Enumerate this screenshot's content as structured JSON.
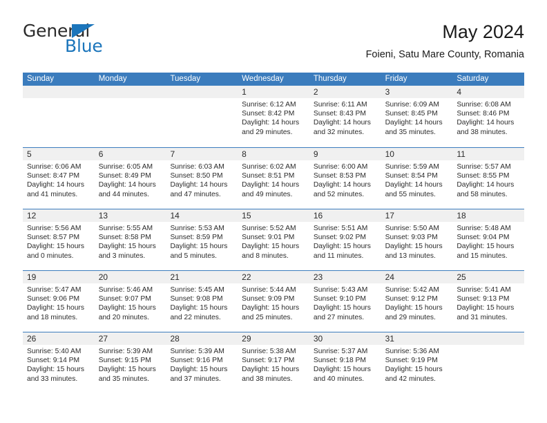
{
  "brand": {
    "line1": "General",
    "line2": "Blue",
    "triangle_color": "#1b75bb"
  },
  "header": {
    "title": "May 2024",
    "subtitle": "Foieni, Satu Mare County, Romania"
  },
  "theme": {
    "header_blue": "#3b7cbd",
    "date_band": "#f0f0f0",
    "text": "#2a2a2a"
  },
  "calendar": {
    "weekday_headers": [
      "Sunday",
      "Monday",
      "Tuesday",
      "Wednesday",
      "Thursday",
      "Friday",
      "Saturday"
    ],
    "weeks": [
      [
        {
          "empty": true,
          "day": "",
          "sunrise": "",
          "sunset": "",
          "daylight_line1": "",
          "daylight_line2": ""
        },
        {
          "empty": true,
          "day": "",
          "sunrise": "",
          "sunset": "",
          "daylight_line1": "",
          "daylight_line2": ""
        },
        {
          "empty": true,
          "day": "",
          "sunrise": "",
          "sunset": "",
          "daylight_line1": "",
          "daylight_line2": ""
        },
        {
          "empty": false,
          "day": "1",
          "sunrise": "Sunrise: 6:12 AM",
          "sunset": "Sunset: 8:42 PM",
          "daylight_line1": "Daylight: 14 hours",
          "daylight_line2": "and 29 minutes."
        },
        {
          "empty": false,
          "day": "2",
          "sunrise": "Sunrise: 6:11 AM",
          "sunset": "Sunset: 8:43 PM",
          "daylight_line1": "Daylight: 14 hours",
          "daylight_line2": "and 32 minutes."
        },
        {
          "empty": false,
          "day": "3",
          "sunrise": "Sunrise: 6:09 AM",
          "sunset": "Sunset: 8:45 PM",
          "daylight_line1": "Daylight: 14 hours",
          "daylight_line2": "and 35 minutes."
        },
        {
          "empty": false,
          "day": "4",
          "sunrise": "Sunrise: 6:08 AM",
          "sunset": "Sunset: 8:46 PM",
          "daylight_line1": "Daylight: 14 hours",
          "daylight_line2": "and 38 minutes."
        }
      ],
      [
        {
          "empty": false,
          "day": "5",
          "sunrise": "Sunrise: 6:06 AM",
          "sunset": "Sunset: 8:47 PM",
          "daylight_line1": "Daylight: 14 hours",
          "daylight_line2": "and 41 minutes."
        },
        {
          "empty": false,
          "day": "6",
          "sunrise": "Sunrise: 6:05 AM",
          "sunset": "Sunset: 8:49 PM",
          "daylight_line1": "Daylight: 14 hours",
          "daylight_line2": "and 44 minutes."
        },
        {
          "empty": false,
          "day": "7",
          "sunrise": "Sunrise: 6:03 AM",
          "sunset": "Sunset: 8:50 PM",
          "daylight_line1": "Daylight: 14 hours",
          "daylight_line2": "and 47 minutes."
        },
        {
          "empty": false,
          "day": "8",
          "sunrise": "Sunrise: 6:02 AM",
          "sunset": "Sunset: 8:51 PM",
          "daylight_line1": "Daylight: 14 hours",
          "daylight_line2": "and 49 minutes."
        },
        {
          "empty": false,
          "day": "9",
          "sunrise": "Sunrise: 6:00 AM",
          "sunset": "Sunset: 8:53 PM",
          "daylight_line1": "Daylight: 14 hours",
          "daylight_line2": "and 52 minutes."
        },
        {
          "empty": false,
          "day": "10",
          "sunrise": "Sunrise: 5:59 AM",
          "sunset": "Sunset: 8:54 PM",
          "daylight_line1": "Daylight: 14 hours",
          "daylight_line2": "and 55 minutes."
        },
        {
          "empty": false,
          "day": "11",
          "sunrise": "Sunrise: 5:57 AM",
          "sunset": "Sunset: 8:55 PM",
          "daylight_line1": "Daylight: 14 hours",
          "daylight_line2": "and 58 minutes."
        }
      ],
      [
        {
          "empty": false,
          "day": "12",
          "sunrise": "Sunrise: 5:56 AM",
          "sunset": "Sunset: 8:57 PM",
          "daylight_line1": "Daylight: 15 hours",
          "daylight_line2": "and 0 minutes."
        },
        {
          "empty": false,
          "day": "13",
          "sunrise": "Sunrise: 5:55 AM",
          "sunset": "Sunset: 8:58 PM",
          "daylight_line1": "Daylight: 15 hours",
          "daylight_line2": "and 3 minutes."
        },
        {
          "empty": false,
          "day": "14",
          "sunrise": "Sunrise: 5:53 AM",
          "sunset": "Sunset: 8:59 PM",
          "daylight_line1": "Daylight: 15 hours",
          "daylight_line2": "and 5 minutes."
        },
        {
          "empty": false,
          "day": "15",
          "sunrise": "Sunrise: 5:52 AM",
          "sunset": "Sunset: 9:01 PM",
          "daylight_line1": "Daylight: 15 hours",
          "daylight_line2": "and 8 minutes."
        },
        {
          "empty": false,
          "day": "16",
          "sunrise": "Sunrise: 5:51 AM",
          "sunset": "Sunset: 9:02 PM",
          "daylight_line1": "Daylight: 15 hours",
          "daylight_line2": "and 11 minutes."
        },
        {
          "empty": false,
          "day": "17",
          "sunrise": "Sunrise: 5:50 AM",
          "sunset": "Sunset: 9:03 PM",
          "daylight_line1": "Daylight: 15 hours",
          "daylight_line2": "and 13 minutes."
        },
        {
          "empty": false,
          "day": "18",
          "sunrise": "Sunrise: 5:48 AM",
          "sunset": "Sunset: 9:04 PM",
          "daylight_line1": "Daylight: 15 hours",
          "daylight_line2": "and 15 minutes."
        }
      ],
      [
        {
          "empty": false,
          "day": "19",
          "sunrise": "Sunrise: 5:47 AM",
          "sunset": "Sunset: 9:06 PM",
          "daylight_line1": "Daylight: 15 hours",
          "daylight_line2": "and 18 minutes."
        },
        {
          "empty": false,
          "day": "20",
          "sunrise": "Sunrise: 5:46 AM",
          "sunset": "Sunset: 9:07 PM",
          "daylight_line1": "Daylight: 15 hours",
          "daylight_line2": "and 20 minutes."
        },
        {
          "empty": false,
          "day": "21",
          "sunrise": "Sunrise: 5:45 AM",
          "sunset": "Sunset: 9:08 PM",
          "daylight_line1": "Daylight: 15 hours",
          "daylight_line2": "and 22 minutes."
        },
        {
          "empty": false,
          "day": "22",
          "sunrise": "Sunrise: 5:44 AM",
          "sunset": "Sunset: 9:09 PM",
          "daylight_line1": "Daylight: 15 hours",
          "daylight_line2": "and 25 minutes."
        },
        {
          "empty": false,
          "day": "23",
          "sunrise": "Sunrise: 5:43 AM",
          "sunset": "Sunset: 9:10 PM",
          "daylight_line1": "Daylight: 15 hours",
          "daylight_line2": "and 27 minutes."
        },
        {
          "empty": false,
          "day": "24",
          "sunrise": "Sunrise: 5:42 AM",
          "sunset": "Sunset: 9:12 PM",
          "daylight_line1": "Daylight: 15 hours",
          "daylight_line2": "and 29 minutes."
        },
        {
          "empty": false,
          "day": "25",
          "sunrise": "Sunrise: 5:41 AM",
          "sunset": "Sunset: 9:13 PM",
          "daylight_line1": "Daylight: 15 hours",
          "daylight_line2": "and 31 minutes."
        }
      ],
      [
        {
          "empty": false,
          "day": "26",
          "sunrise": "Sunrise: 5:40 AM",
          "sunset": "Sunset: 9:14 PM",
          "daylight_line1": "Daylight: 15 hours",
          "daylight_line2": "and 33 minutes."
        },
        {
          "empty": false,
          "day": "27",
          "sunrise": "Sunrise: 5:39 AM",
          "sunset": "Sunset: 9:15 PM",
          "daylight_line1": "Daylight: 15 hours",
          "daylight_line2": "and 35 minutes."
        },
        {
          "empty": false,
          "day": "28",
          "sunrise": "Sunrise: 5:39 AM",
          "sunset": "Sunset: 9:16 PM",
          "daylight_line1": "Daylight: 15 hours",
          "daylight_line2": "and 37 minutes."
        },
        {
          "empty": false,
          "day": "29",
          "sunrise": "Sunrise: 5:38 AM",
          "sunset": "Sunset: 9:17 PM",
          "daylight_line1": "Daylight: 15 hours",
          "daylight_line2": "and 38 minutes."
        },
        {
          "empty": false,
          "day": "30",
          "sunrise": "Sunrise: 5:37 AM",
          "sunset": "Sunset: 9:18 PM",
          "daylight_line1": "Daylight: 15 hours",
          "daylight_line2": "and 40 minutes."
        },
        {
          "empty": false,
          "day": "31",
          "sunrise": "Sunrise: 5:36 AM",
          "sunset": "Sunset: 9:19 PM",
          "daylight_line1": "Daylight: 15 hours",
          "daylight_line2": "and 42 minutes."
        },
        {
          "empty": true,
          "day": "",
          "sunrise": "",
          "sunset": "",
          "daylight_line1": "",
          "daylight_line2": ""
        }
      ]
    ]
  }
}
